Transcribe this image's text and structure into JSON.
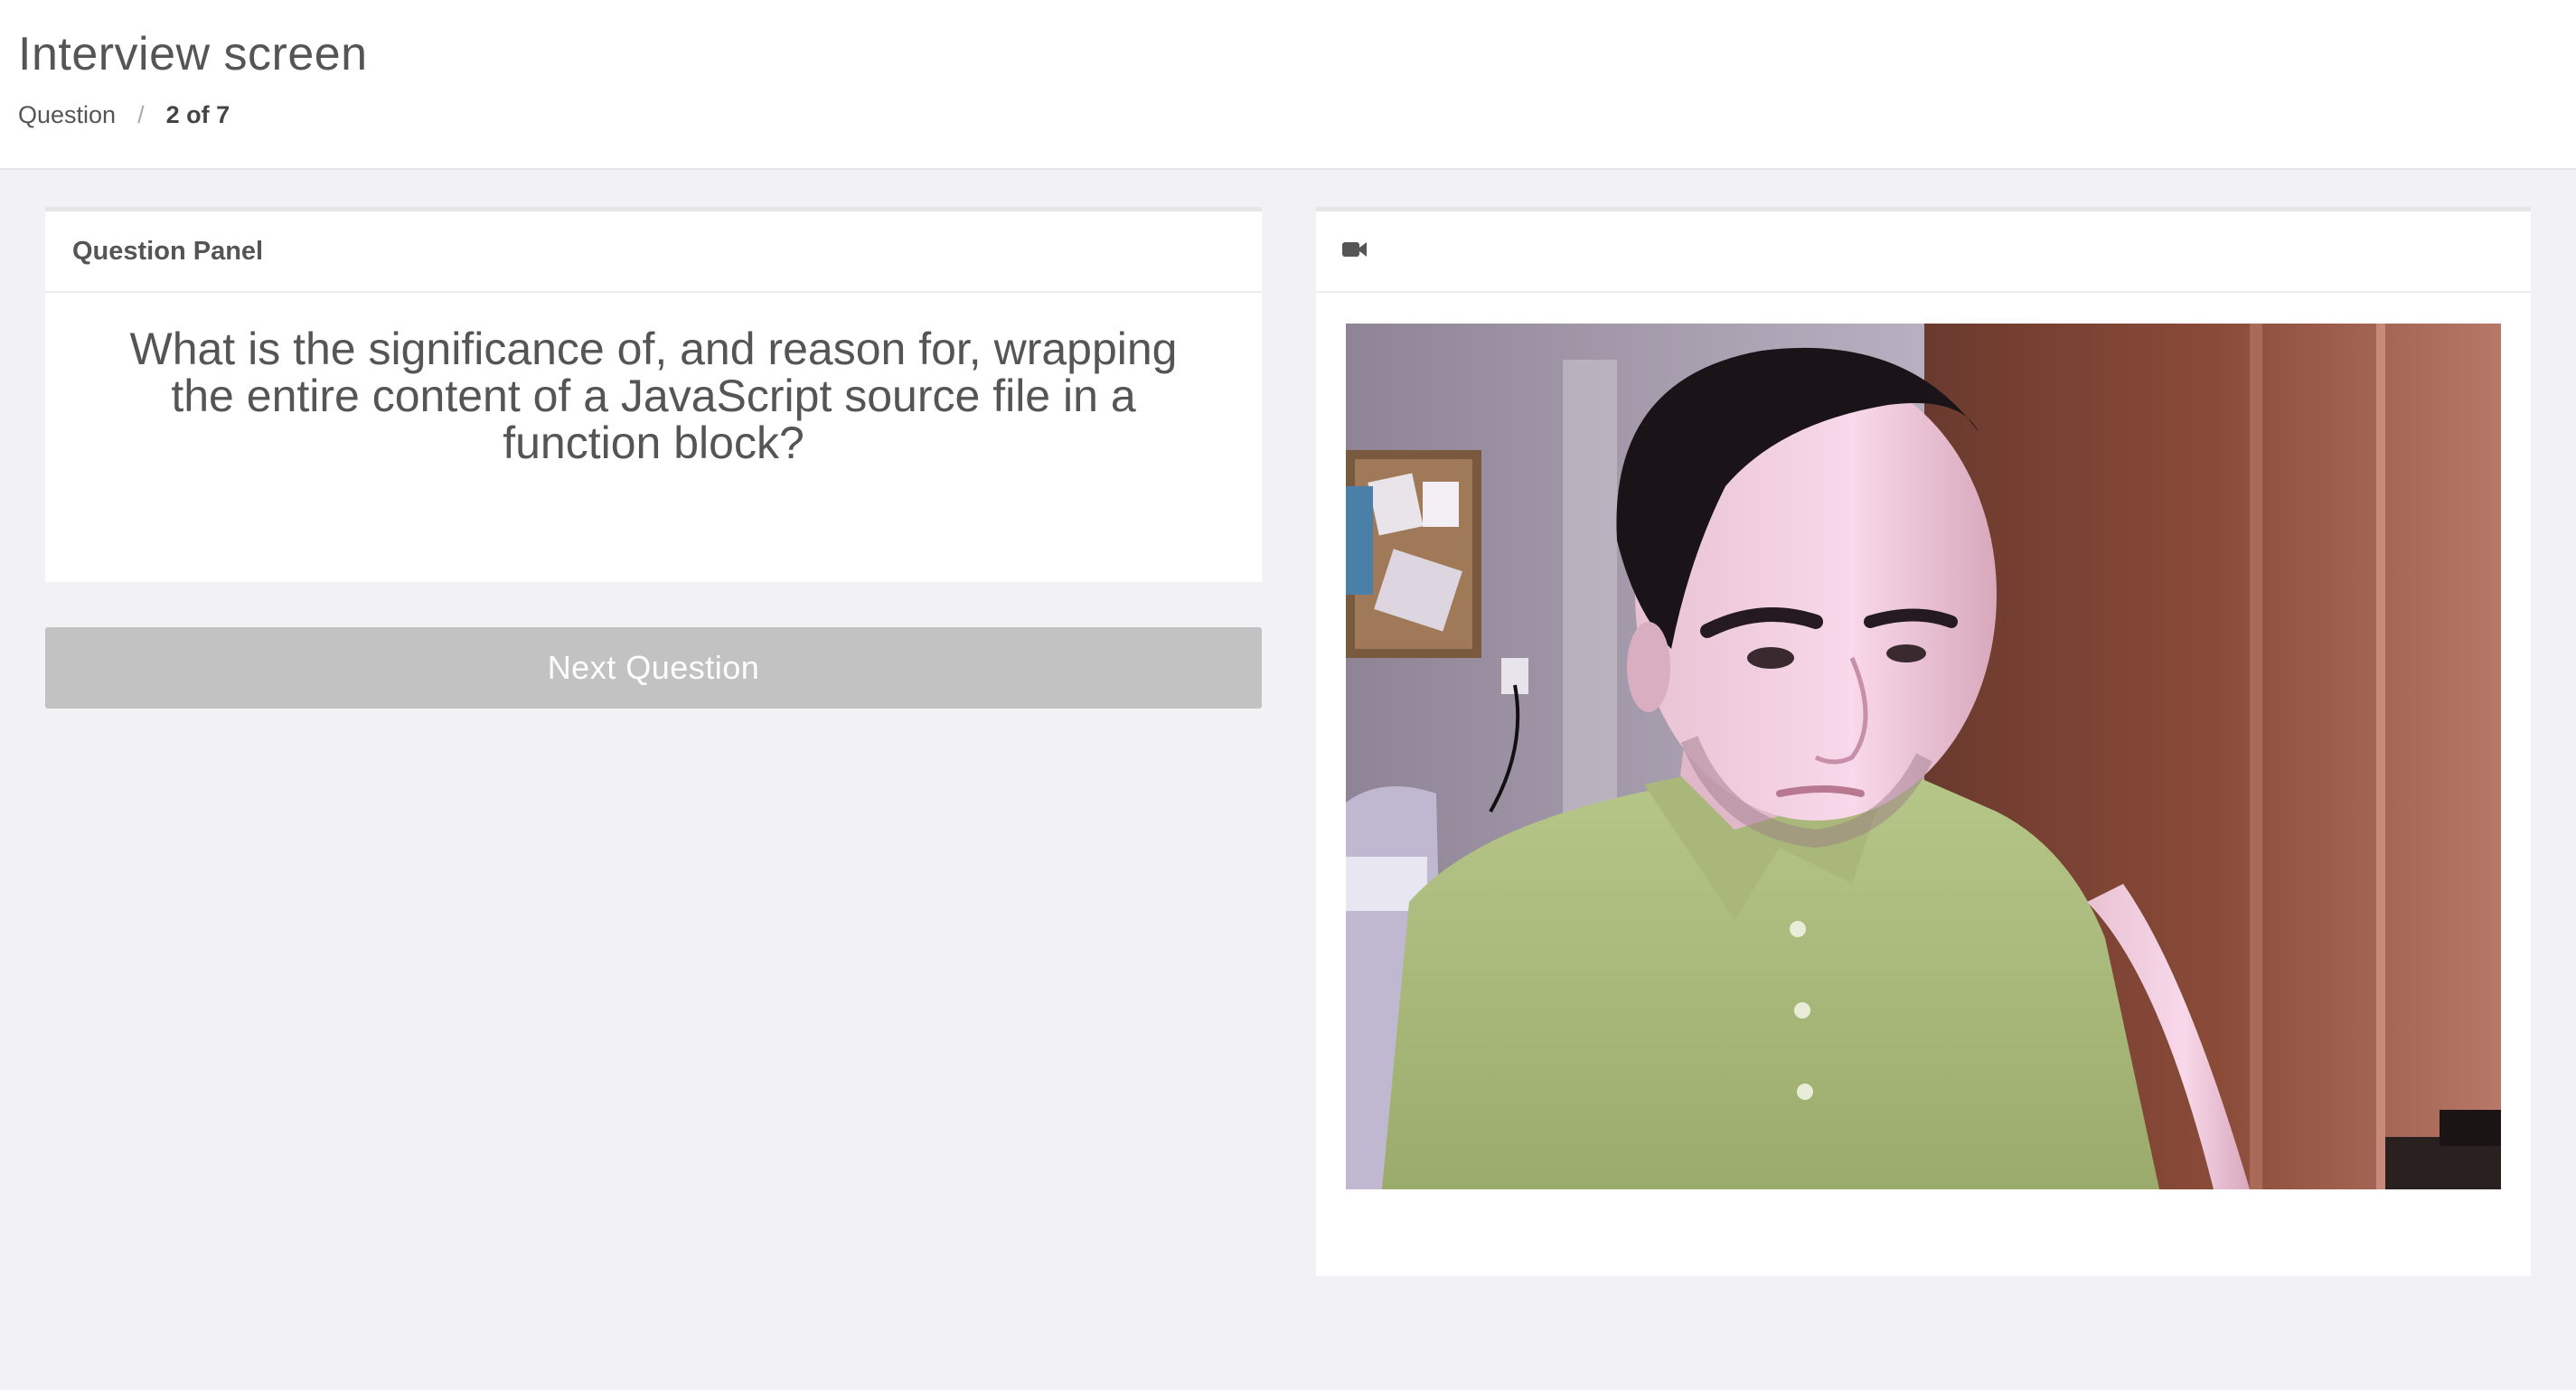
{
  "header": {
    "title": "Interview screen",
    "breadcrumb": {
      "section": "Question",
      "separator": "/",
      "progress": "2 of 7"
    }
  },
  "question_panel": {
    "heading": "Question Panel",
    "question": "What is the significance of, and reason for, wrapping the entire content of a JavaScript source file in a function block?"
  },
  "actions": {
    "next_label": "Next Question"
  },
  "video_panel": {
    "icon": "video-camera-icon"
  },
  "colors": {
    "page_background": "#f2f2f4",
    "panel_background": "#ffffff",
    "button_disabled": "#c2c2c2",
    "text": "#555555"
  }
}
